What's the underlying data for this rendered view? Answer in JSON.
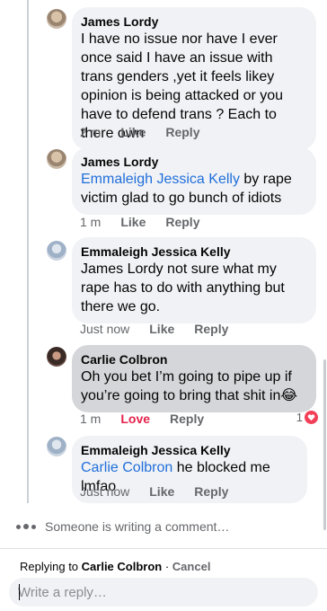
{
  "comments": [
    {
      "author": "James Lordy",
      "text": "I have no issue nor have I ever once said I have an issue with trans genders ,yet it feels likey opinion is being attacked or you have to defend trans ? Each to there own",
      "time": "2 m",
      "like": "Like",
      "reply": "Reply"
    },
    {
      "author": "James Lordy",
      "mention": "Emmaleigh Jessica Kelly",
      "text": "  by rape victim glad to go  bunch of idiots",
      "time": "1 m",
      "like": "Like",
      "reply": "Reply"
    },
    {
      "author": "Emmaleigh Jessica Kelly",
      "text": "James Lordy not sure what my rape has to do with anything but there we go.",
      "time": "Just now",
      "like": "Like",
      "reply": "Reply"
    },
    {
      "author": "Carlie Colbron",
      "text": "Oh you bet I’m going to pipe up if you’re going to bring that shit in",
      "emoji": "😂",
      "time": "1 m",
      "like": "Love",
      "reply": "Reply",
      "reaction_count": "1"
    },
    {
      "author": "Emmaleigh Jessica Kelly",
      "mention": "Carlie Colbron",
      "text": " he blocked me lmfao",
      "time": "Just now",
      "like": "Like",
      "reply": "Reply"
    }
  ],
  "typing": "Someone is writing a comment…",
  "reply_bar": {
    "prefix": "Replying to ",
    "target": "Carlie Colbron",
    "separator": " · ",
    "cancel": "Cancel",
    "placeholder": "Write a reply…"
  },
  "colors": {
    "bubble": "#f0f2f5",
    "highlight": "#d4d6d9",
    "mention": "#216fdb",
    "love": "#e4234b",
    "meta": "#65676b"
  }
}
